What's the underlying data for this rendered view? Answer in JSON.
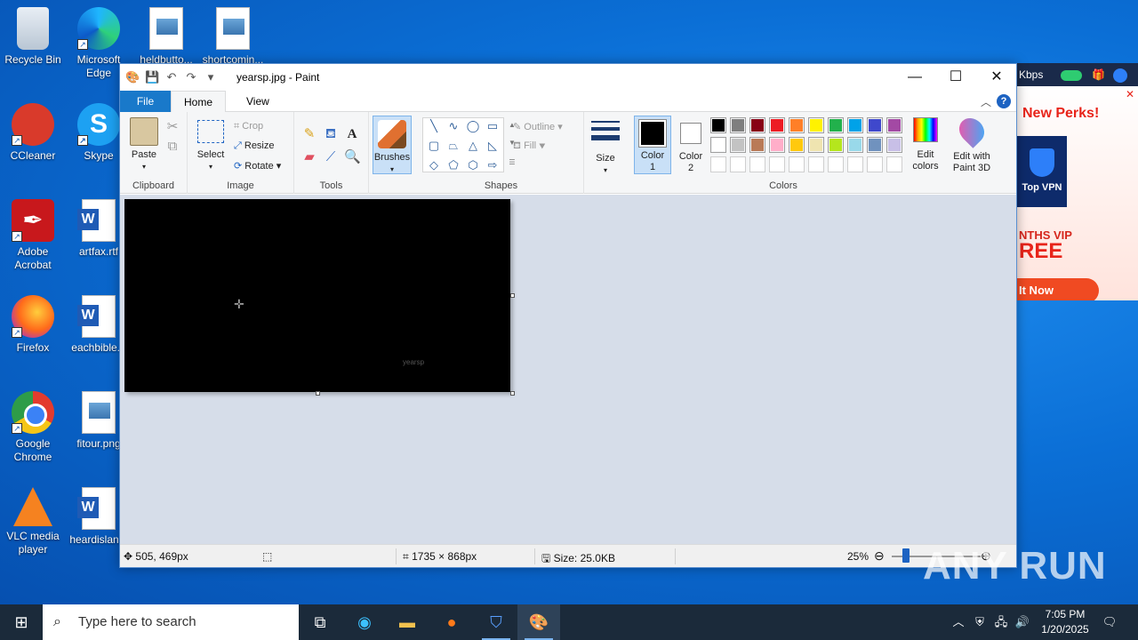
{
  "desktop": {
    "icons": [
      {
        "label": "Recycle Bin"
      },
      {
        "label": "Microsoft Edge"
      },
      {
        "label": "heldbutto..."
      },
      {
        "label": "shortcomin..."
      },
      {
        "label": "CCleaner"
      },
      {
        "label": "Skype"
      },
      {
        "label": "Adobe Acrobat"
      },
      {
        "label": "artfax.rtf"
      },
      {
        "label": "Firefox"
      },
      {
        "label": "eachbible..."
      },
      {
        "label": "Google Chrome"
      },
      {
        "label": "fitour.png"
      },
      {
        "label": "VLC media player"
      },
      {
        "label": "heardislan..."
      }
    ]
  },
  "paint": {
    "title": "yearsp.jpg - Paint",
    "tabs": {
      "file": "File",
      "home": "Home",
      "view": "View"
    },
    "help": "?",
    "clipboard": {
      "paste": "Paste",
      "group": "Clipboard"
    },
    "image": {
      "select": "Select",
      "crop": "Crop",
      "resize": "Resize",
      "rotate": "Rotate",
      "group": "Image"
    },
    "tools": {
      "text_glyph": "A",
      "group": "Tools"
    },
    "brushes": {
      "label": "Brushes"
    },
    "shapes": {
      "outline": "Outline",
      "fill": "Fill",
      "group": "Shapes"
    },
    "size": {
      "label": "Size"
    },
    "colors": {
      "color1": "Color 1",
      "color2": "Color 2",
      "edit": "Edit colors",
      "paint3d": "Edit with Paint 3D",
      "group": "Colors",
      "color1_value": "#000000",
      "color2_value": "#ffffff",
      "palette_row1": [
        "#000000",
        "#7f7f7f",
        "#880015",
        "#ed1c24",
        "#ff7f27",
        "#fff200",
        "#22b14c",
        "#00a2e8",
        "#3f48cc",
        "#a349a4"
      ],
      "palette_row2": [
        "#ffffff",
        "#c3c3c3",
        "#b97a57",
        "#ffaec9",
        "#ffc90e",
        "#efe4b0",
        "#b5e61d",
        "#99d9ea",
        "#7092be",
        "#c8bfe7"
      ]
    },
    "canvas_text": "yearsp",
    "status": {
      "cursor_pos": "505, 469px",
      "image_size": "1735 × 868px",
      "file_size": "Size: 25.0KB",
      "zoom": "25%"
    }
  },
  "ad": {
    "speed": "Kbps",
    "title": "New Perks!",
    "vpn": "Top VPN",
    "vip": "NTHS VIP",
    "free": "REE",
    "cta": "It Now"
  },
  "taskbar": {
    "search_placeholder": "Type here to search",
    "time": "7:05 PM",
    "date": "1/20/2025"
  },
  "watermark": "ANY RUN"
}
